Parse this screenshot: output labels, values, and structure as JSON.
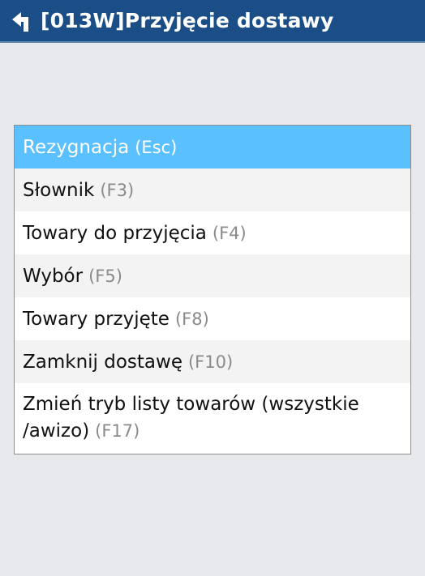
{
  "header": {
    "title": "[013W]Przyjęcie dostawy",
    "back_icon": "return-arrow-icon",
    "background": "#1b4e86"
  },
  "menu": {
    "selected_color": "#5bc0ff",
    "items": [
      {
        "label": "Rezygnacja",
        "key": "(Esc)"
      },
      {
        "label": "Słownik",
        "key": "(F3)"
      },
      {
        "label": "Towary do przyjęcia",
        "key": "(F4)"
      },
      {
        "label": "Wybór",
        "key": "(F5)"
      },
      {
        "label": "Towary przyjęte",
        "key": "(F8)"
      },
      {
        "label": "Zamknij dostawę",
        "key": "(F10)"
      },
      {
        "label": "Zmień tryb listy towarów (wszystkie /awizo)",
        "key": "(F17)"
      }
    ]
  }
}
